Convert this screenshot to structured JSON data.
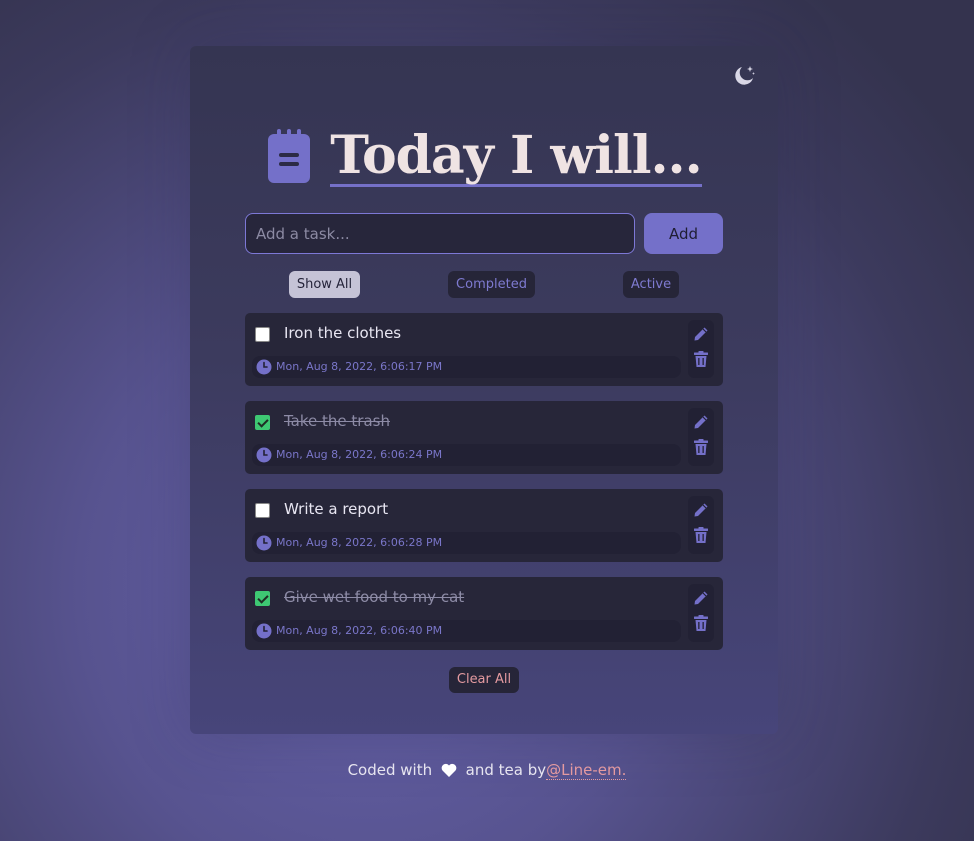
{
  "header": {
    "title": "Today I will..."
  },
  "add_form": {
    "placeholder": "Add a task...",
    "add_label": "Add"
  },
  "filters": {
    "show_all": "Show All",
    "completed": "Completed",
    "active": "Active"
  },
  "tasks": [
    {
      "text": "Iron the clothes",
      "completed": false,
      "timestamp": "Mon, Aug 8, 2022, 6:06:17 PM"
    },
    {
      "text": "Take the trash",
      "completed": true,
      "timestamp": "Mon, Aug 8, 2022, 6:06:24 PM"
    },
    {
      "text": "Write a report",
      "completed": false,
      "timestamp": "Mon, Aug 8, 2022, 6:06:28 PM"
    },
    {
      "text": "Give wet food to my cat",
      "completed": true,
      "timestamp": "Mon, Aug 8, 2022, 6:06:40 PM"
    }
  ],
  "clear_label": "Clear All",
  "footer": {
    "prefix": "Coded with",
    "middle": "and tea by",
    "author": "@Line-em."
  },
  "colors": {
    "accent": "#7470c9",
    "completed_check": "#3ec873",
    "link": "#e49aa0"
  },
  "icons": [
    "moon-stars-icon",
    "notepad-icon",
    "clock-icon",
    "pencil-icon",
    "trash-icon",
    "heart-icon"
  ]
}
